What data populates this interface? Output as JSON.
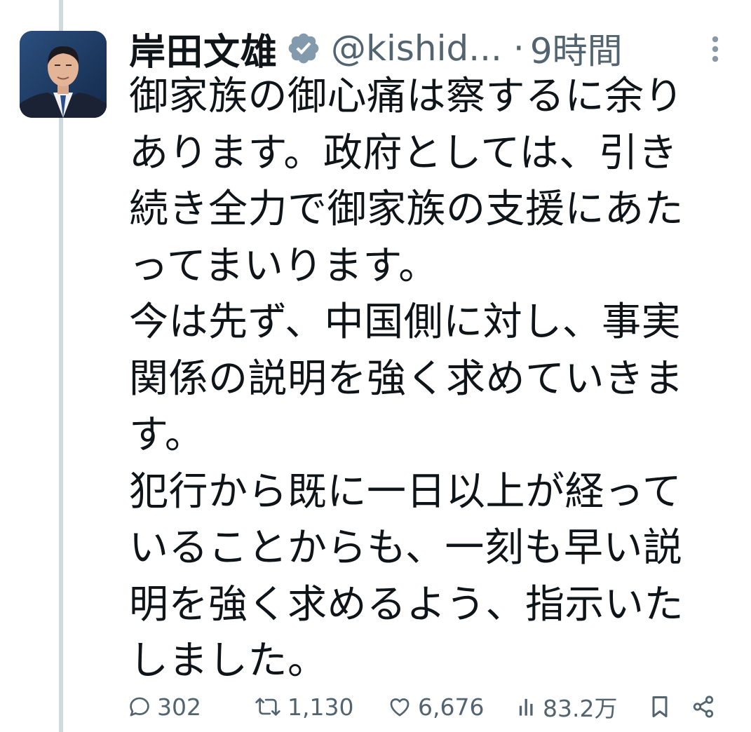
{
  "tweet": {
    "display_name": "岸田文雄",
    "handle": "@kishid...",
    "separator": "·",
    "time": "9時間",
    "body": "御家族の御心痛は察するに余りあります。政府としては、引き続き全力で御家族の支援にあたってまいります。\n今は先ず、中国側に対し、事実関係の説明を強く求めていきます。\n犯行から既に一日以上が経っていることからも、一刻も早い説明を強く求めるよう、指示いたしました。",
    "icons": {
      "verified": "verified-badge-icon",
      "more": "more-vertical-icon"
    }
  },
  "actions": {
    "reply_count": "302",
    "retweet_count": "1,130",
    "like_count": "6,676",
    "view_count": "83.2万",
    "icons": [
      "reply-icon",
      "retweet-icon",
      "like-icon",
      "views-icon",
      "bookmark-icon",
      "share-icon"
    ]
  },
  "colors": {
    "text": "#0f1419",
    "secondary": "#536471",
    "thread_line": "#cfd9de",
    "verified": "#829aab"
  }
}
